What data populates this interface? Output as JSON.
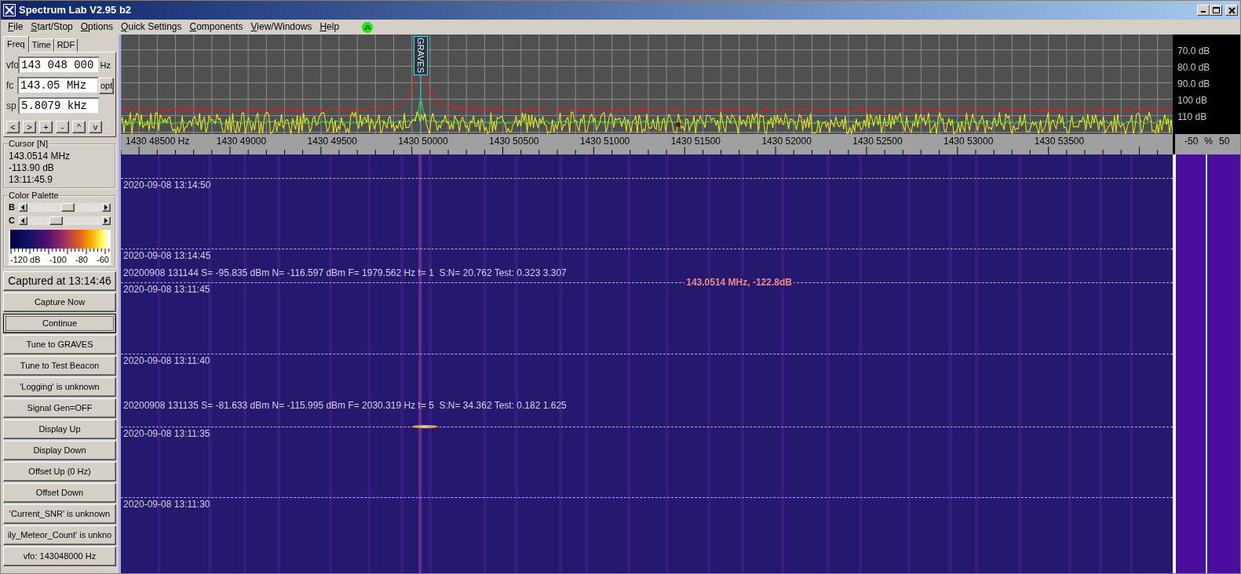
{
  "window": {
    "title": "Spectrum Lab V2.95 b2"
  },
  "menu": [
    "File",
    "Start/Stop",
    "Options",
    "Quick Settings",
    "Components",
    "View/Windows",
    "Help"
  ],
  "tabs": [
    {
      "label": "Freq",
      "selected": true
    },
    {
      "label": "Time",
      "selected": false
    },
    {
      "label": "RDF",
      "selected": false
    }
  ],
  "freq_fields": [
    {
      "label": "vfo",
      "value": "143 048 000",
      "unit": "Hz"
    },
    {
      "label": "fc",
      "value": "143.05 MHz",
      "button": "opt"
    },
    {
      "label": "sp",
      "value": "5.8079 kHz"
    }
  ],
  "step_buttons": [
    "<",
    ">",
    "+",
    "-",
    "^",
    "v"
  ],
  "cursor": {
    "title": "Cursor [N]",
    "lines": [
      "143.0514 MHz",
      "-113.90 dB",
      "13:11:45.9"
    ]
  },
  "color_palette": {
    "title": "Color Palette",
    "sliders": [
      {
        "label": "B",
        "level": 0.55
      },
      {
        "label": "C",
        "level": 0.36
      }
    ],
    "scale_labels": [
      "-120 dB",
      "-100",
      "-80",
      "-60"
    ]
  },
  "buttons": [
    {
      "label": "Captured at 13:14:46",
      "kind": "large",
      "focused": false
    },
    {
      "label": "Capture Now",
      "kind": "normal",
      "focused": false
    },
    {
      "label": "Continue",
      "kind": "normal",
      "focused": true
    },
    {
      "label": "Tune to GRAVES",
      "kind": "normal",
      "focused": false
    },
    {
      "label": "Tune to Test Beacon",
      "kind": "normal",
      "focused": false
    },
    {
      "label": "'Logging' is unknown",
      "kind": "normal",
      "focused": false
    },
    {
      "label": "Signal Gen=OFF",
      "kind": "normal",
      "focused": false
    },
    {
      "label": "Display Up",
      "kind": "normal",
      "focused": false
    },
    {
      "label": "Display Down",
      "kind": "normal",
      "focused": false
    },
    {
      "label": "Offset Up (0 Hz)",
      "kind": "normal",
      "focused": false
    },
    {
      "label": "Offset Down",
      "kind": "normal",
      "focused": false
    },
    {
      "label": "'Current_SNR' is unknown",
      "kind": "normal",
      "focused": false
    },
    {
      "label": "ily_Meteor_Count' is unkno",
      "kind": "normal",
      "focused": false
    },
    {
      "label": "vfo: 143048000 Hz",
      "kind": "normal",
      "focused": false
    }
  ],
  "spectrum": {
    "marker": "GRAVES",
    "db_labels": [
      "70.0 dB",
      "80.0 dB",
      "90.0 dB",
      "100 dB",
      "110 dB"
    ],
    "freq_labels": [
      "1430 48500 Hz",
      "1430 49000",
      "1430 49500",
      "1430 50000",
      "1430 50500",
      "1430 51000",
      "1430 51500",
      "1430 52000",
      "1430 52500",
      "1430 53000",
      "1430 53500"
    ],
    "level_labels": [
      "-50",
      "%",
      "50"
    ]
  },
  "waterfall": [
    {
      "kind": "timestamp",
      "text": "2020-09-08 13:14:50"
    },
    {
      "kind": "timestamp",
      "text": "2020-09-08 13:14:45"
    },
    {
      "kind": "log",
      "text": "20200908 131144 S= -95.835 dBm N= -116.597 dBm F= 1979.562 Hz t= 1  S:N= 20.762 Test: 0.323 3.307"
    },
    {
      "kind": "readout",
      "text": "143.0514 MHz, -122.8dB"
    },
    {
      "kind": "timestamp",
      "text": "2020-09-08 13:11:45"
    },
    {
      "kind": "timestamp",
      "text": "2020-09-08 13:11:40"
    },
    {
      "kind": "log",
      "text": "20200908 131135 S= -81.633 dBm N= -115.995 dBm F= 2030.319 Hz t= 5  S:N= 34.362 Test: 0.182 1.625"
    },
    {
      "kind": "timestamp",
      "text": "2020-09-08 13:11:35"
    },
    {
      "kind": "timestamp",
      "text": "2020-09-08 13:11:30"
    }
  ]
}
